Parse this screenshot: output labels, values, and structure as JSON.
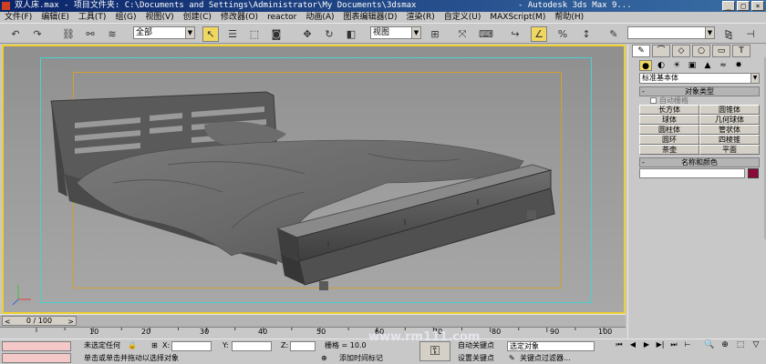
{
  "window": {
    "title": "双人床.max    - 项目文件夹: C:\\Documents and Settings\\Administrator\\My Documents\\3dsmax",
    "product": "- Autodesk 3ds Max 9...",
    "minimize": "_",
    "maximize": "□",
    "close": "×"
  },
  "menu": [
    "文件(F)",
    "编辑(E)",
    "工具(T)",
    "组(G)",
    "视图(V)",
    "创建(C)",
    "修改器(O)",
    "reactor",
    "动画(A)",
    "图表编辑器(D)",
    "渲染(R)",
    "自定义(U)",
    "MAXScript(M)",
    "帮助(H)"
  ],
  "toolbar": {
    "selection_filter": "全部",
    "reference_coord": "视图"
  },
  "timeline": {
    "slider_label": "0 / 100",
    "arrow_left": "<",
    "arrow_right": ">",
    "ticks": [
      "10",
      "20",
      "30",
      "40",
      "50",
      "60",
      "70",
      "80",
      "90",
      "100"
    ]
  },
  "status": {
    "selection": "未选定任何",
    "x_label": "X:",
    "y_label": "Y:",
    "z_label": "Z:",
    "grid_text": "栅格 = 10.0",
    "prompt": "单击或单击并拖动以选择对象",
    "add_time_tag": "添加时间标记",
    "auto_key": "自动关键点",
    "set_key": "设置关键点",
    "selected_object": "选定对象",
    "key_filter": "关键点过滤器..."
  },
  "watermark": "www.rm111.com",
  "command_panel": {
    "tabs": [
      "✎",
      "⌒",
      "◇",
      "○",
      "▭",
      "T"
    ],
    "dropdown": "标准基本体",
    "rollout_object_type": "对象类型",
    "autogrid": "自动栅格",
    "primitives": [
      "长方体",
      "圆锥体",
      "球体",
      "几何球体",
      "圆柱体",
      "管状体",
      "圆环",
      "四棱锥",
      "茶壶",
      "平面"
    ],
    "rollout_name_color": "名称和颜色",
    "minus": "-"
  },
  "icons": {
    "undo": "undo-icon",
    "redo": "redo-icon",
    "select": "select-arrow-icon",
    "move": "move-icon",
    "rotate": "rotate-icon",
    "scale": "scale-icon"
  },
  "colors": {
    "viewport_border": "#f0d030",
    "safe_frame_outer": "#4ad0d0",
    "safe_frame_inner": "#d0a030",
    "object_color": "#8b0a3a"
  }
}
